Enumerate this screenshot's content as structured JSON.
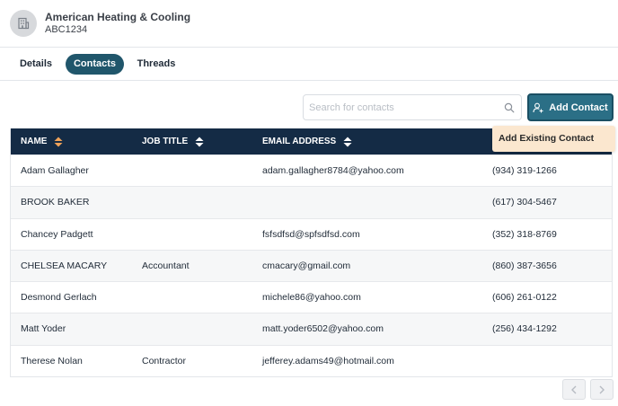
{
  "company": {
    "name": "American Heating & Cooling",
    "code": "ABC1234"
  },
  "tabs": [
    {
      "label": "Details"
    },
    {
      "label": "Contacts"
    },
    {
      "label": "Threads"
    }
  ],
  "search": {
    "placeholder": "Search for contacts"
  },
  "add_contact": {
    "label": "Add Contact",
    "dropdown_item": "Add Existing Contact"
  },
  "table": {
    "columns": [
      "NAME",
      "JOB TITLE",
      "EMAIL ADDRESS"
    ],
    "rows": [
      {
        "name": "Adam Gallagher",
        "job": "",
        "email": "adam.gallagher8784@yahoo.com",
        "phone": "(934) 319-1266"
      },
      {
        "name": "BROOK BAKER",
        "job": "",
        "email": "",
        "phone": "(617) 304-5467"
      },
      {
        "name": "Chancey Padgett",
        "job": "",
        "email": "fsfsdfsd@spfsdfsd.com",
        "phone": "(352) 318-8769"
      },
      {
        "name": "CHELSEA MACARY",
        "job": "Accountant",
        "email": "cmacary@gmail.com",
        "phone": "(860) 387-3656"
      },
      {
        "name": "Desmond Gerlach",
        "job": "",
        "email": "michele86@yahoo.com",
        "phone": "(606) 261-0122"
      },
      {
        "name": "Matt Yoder",
        "job": "",
        "email": "matt.yoder6502@yahoo.com",
        "phone": "(256) 434-1292"
      },
      {
        "name": "Therese Nolan",
        "job": "Contractor",
        "email": "jefferey.adams49@hotmail.com",
        "phone": ""
      }
    ]
  },
  "colors": {
    "accent": "#20566b",
    "table_header": "#142b45",
    "dropdown_bg": "#fbe7cf"
  }
}
